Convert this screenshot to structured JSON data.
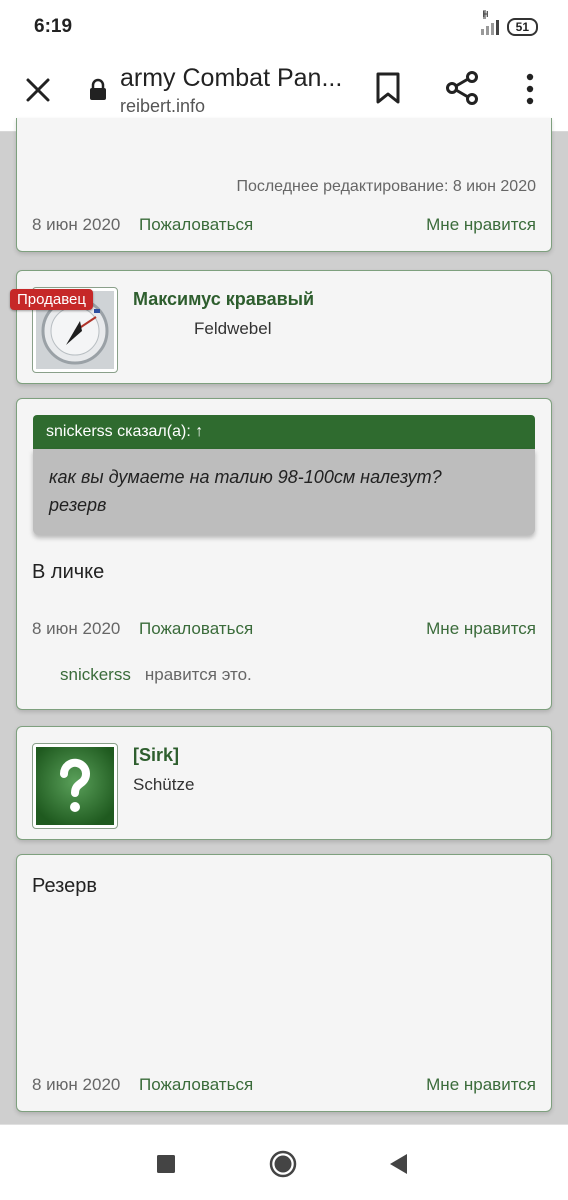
{
  "status_bar": {
    "time": "6:19",
    "signal_label": "H",
    "battery": "51"
  },
  "browser": {
    "title": "army Combat Pan...",
    "url": "reibert.info"
  },
  "posts": [
    {
      "edited": "Последнее редактирование: 8 июн 2020",
      "date": "8 июн 2020",
      "report": "Пожаловаться",
      "like": "Мне нравится"
    }
  ],
  "user1": {
    "badge": "Продавец",
    "name": "Максимус крававый",
    "title": "Feldwebel"
  },
  "quote_post": {
    "quote_header": "snickerss сказал(а): ↑",
    "quote_line1": "как вы думаете на талию 98-100см налезут?",
    "quote_line2": "резерв",
    "text": "В личке",
    "date": "8 июн 2020",
    "report": "Пожаловаться",
    "like": "Мне нравится",
    "liked_by": "snickerss",
    "liked_suffix": "нравится это."
  },
  "user2": {
    "name": "[Sirk]",
    "title": "Schütze"
  },
  "reserve_post": {
    "text": "Резерв",
    "date": "8 июн 2020",
    "report": "Пожаловаться",
    "like": "Мне нравится"
  },
  "colors": {
    "accent_green": "#2f6b2f",
    "badge_red": "#c62828"
  }
}
